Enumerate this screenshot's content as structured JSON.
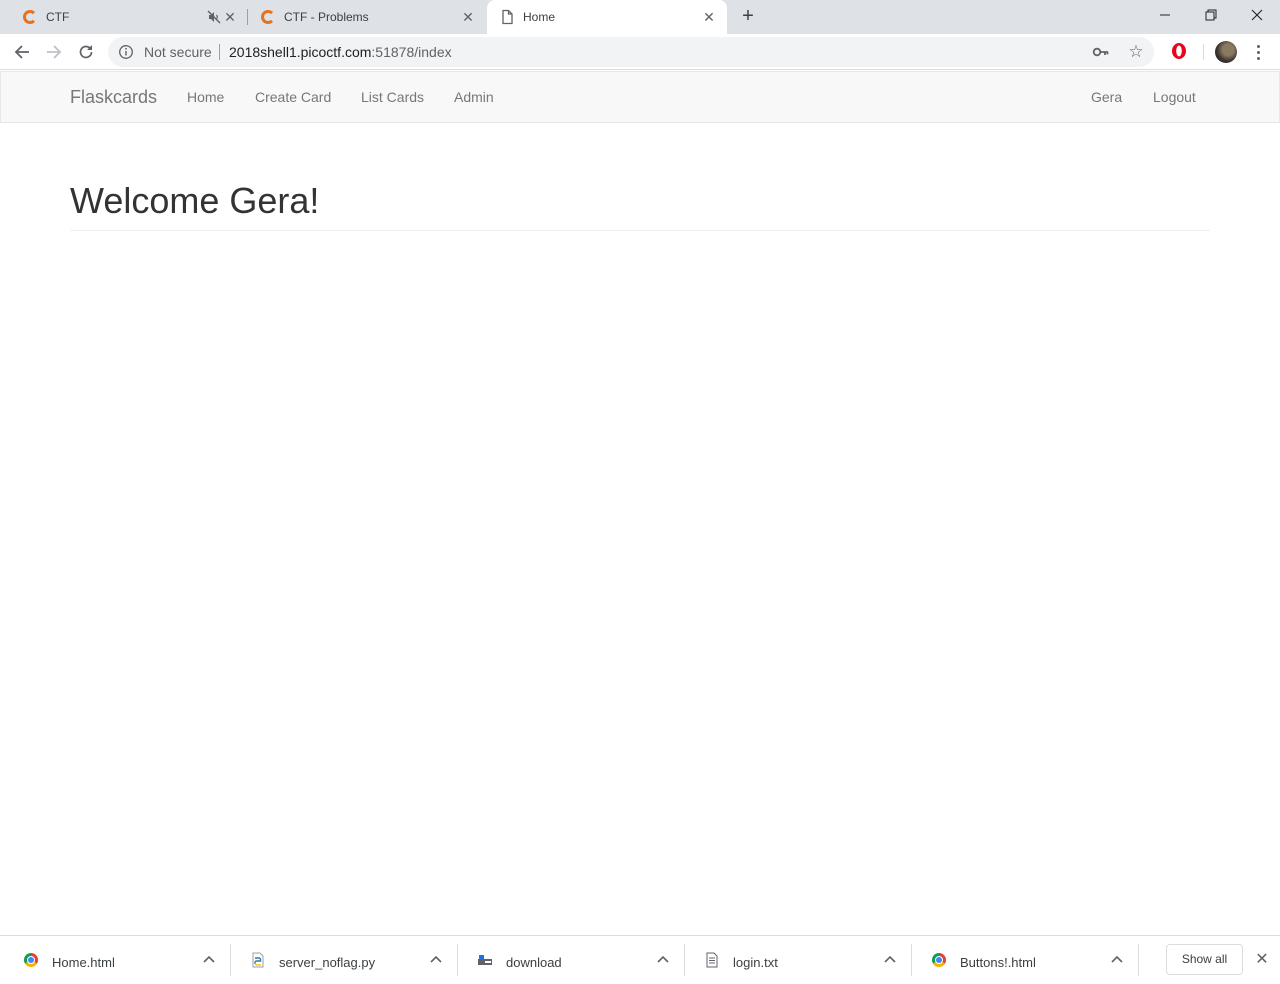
{
  "browser": {
    "tabs": [
      {
        "title": "CTF",
        "favicon": "ctf-icon",
        "muted": true,
        "active": false
      },
      {
        "title": "CTF - Problems",
        "favicon": "ctf-icon",
        "muted": false,
        "active": false
      },
      {
        "title": "Home",
        "favicon": "page-icon",
        "muted": false,
        "active": true
      }
    ],
    "new_tab_label": "+",
    "window_controls": {
      "minimize": "minimize-icon",
      "restore": "restore-icon",
      "close": "close-icon"
    },
    "toolbar": {
      "security_label": "Not secure",
      "url_host": "2018shell1.picoctf.com",
      "url_rest": ":51878/index"
    }
  },
  "site": {
    "brand": "Flaskcards",
    "nav_left": [
      "Home",
      "Create Card",
      "List Cards",
      "Admin"
    ],
    "nav_right": [
      "Gera",
      "Logout"
    ],
    "heading": "Welcome Gera!"
  },
  "downloads": {
    "items": [
      {
        "name": "Home.html",
        "icon": "chrome-file-icon"
      },
      {
        "name": "server_noflag.py",
        "icon": "python-file-icon"
      },
      {
        "name": "download",
        "icon": "generic-file-icon"
      },
      {
        "name": "login.txt",
        "icon": "text-file-icon"
      },
      {
        "name": "Buttons!.html",
        "icon": "chrome-file-icon"
      }
    ],
    "show_all_label": "Show all"
  },
  "colors": {
    "accent_ctf": "#e8711d",
    "tabstrip_bg": "#dee1e6",
    "navbar_bg": "#f8f8f8",
    "nav_text": "#777777",
    "heading_text": "#333333"
  }
}
